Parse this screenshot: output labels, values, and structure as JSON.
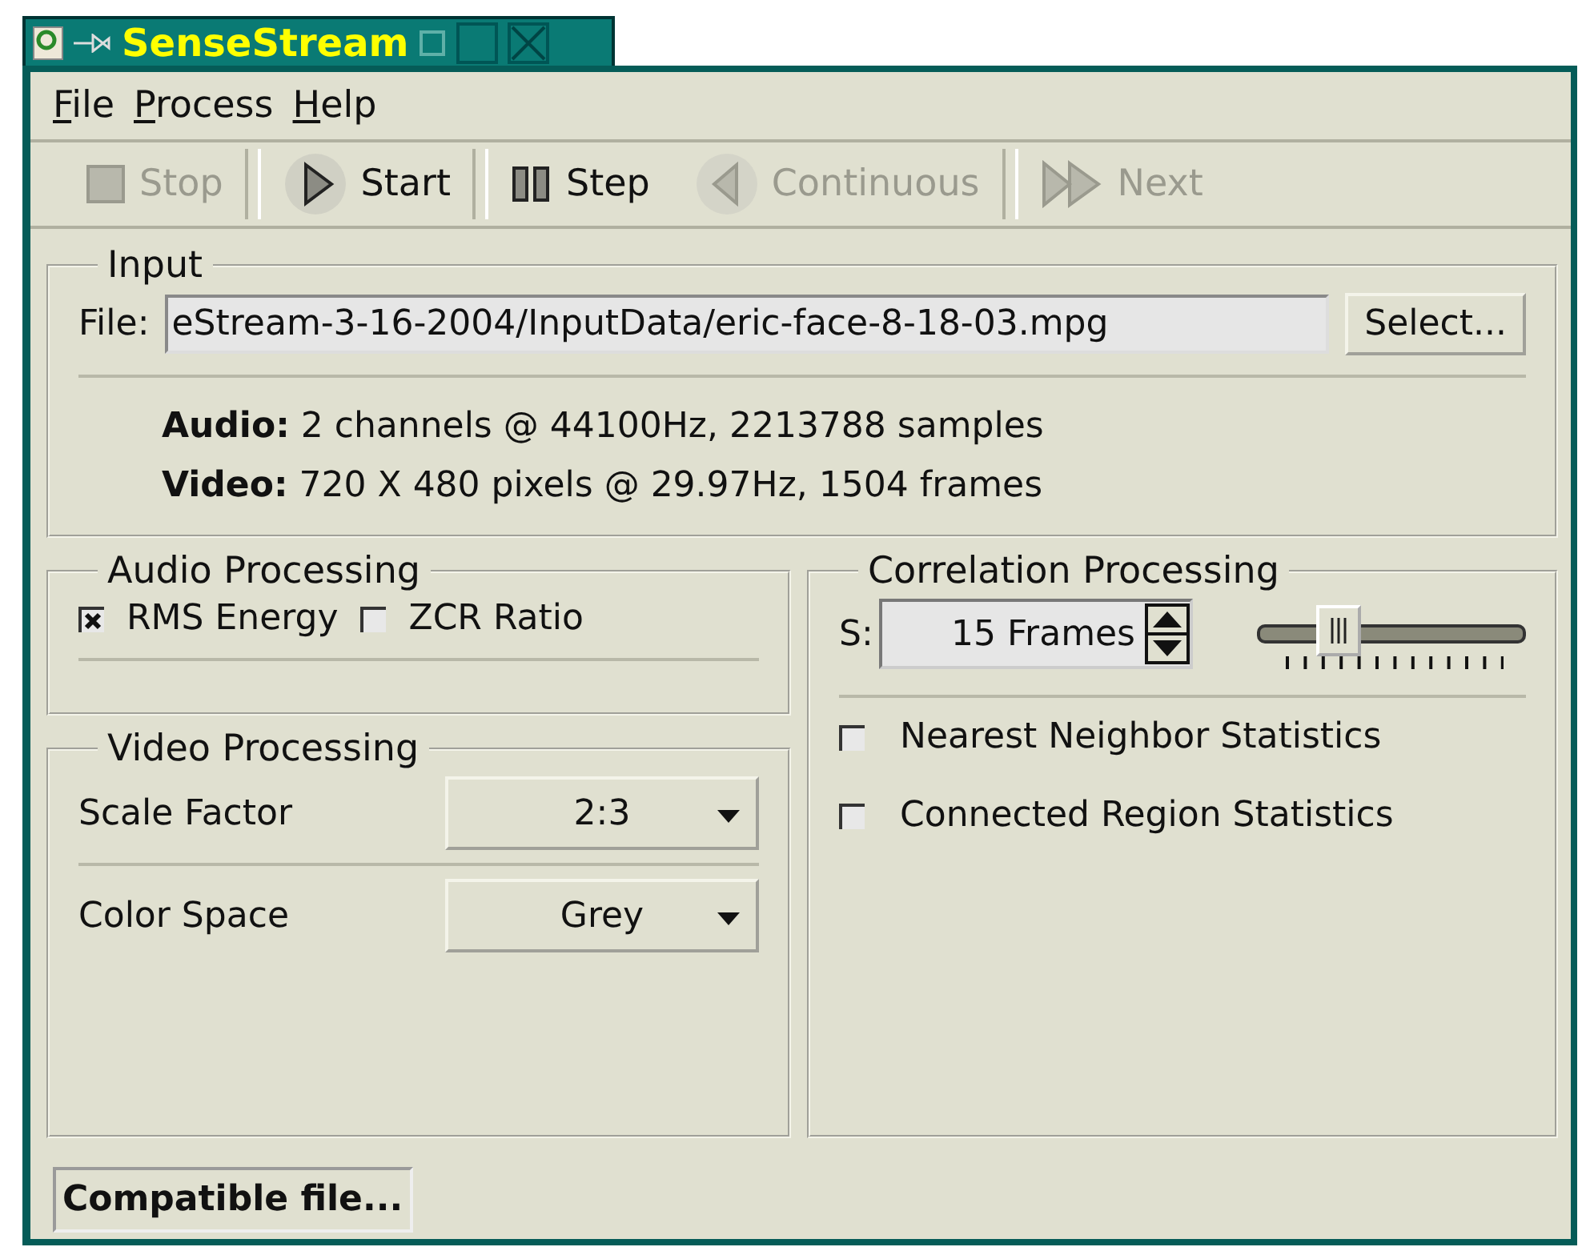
{
  "window": {
    "title": "SenseStream"
  },
  "menu": [
    {
      "label": "File"
    },
    {
      "label": "Process"
    },
    {
      "label": "Help"
    }
  ],
  "toolbar": [
    {
      "label": "Stop",
      "kind": "stop",
      "disabled": true
    },
    {
      "label": "Start",
      "kind": "play",
      "disabled": false
    },
    {
      "label": "Step",
      "kind": "pause",
      "disabled": false
    },
    {
      "label": "Continuous",
      "kind": "back",
      "disabled": true
    },
    {
      "label": "Next",
      "kind": "forward",
      "disabled": true
    }
  ],
  "input": {
    "title": "Input",
    "file_label": "File:",
    "file_value": "eStream-3-16-2004/InputData/eric-face-8-18-03.mpg",
    "select_button": "Select...",
    "info": [
      {
        "label": "Audio:",
        "text": "2 channels @ 44100Hz, 2213788 samples"
      },
      {
        "label": "Video:",
        "text": "720 X 480 pixels @ 29.97Hz, 1504 frames"
      }
    ]
  },
  "audio_processing": {
    "title": "Audio Processing",
    "options": [
      {
        "label": "RMS Energy",
        "checked": true
      },
      {
        "label": "ZCR Ratio",
        "checked": false
      }
    ]
  },
  "video_processing": {
    "title": "Video Processing",
    "fields": [
      {
        "label": "Scale Factor",
        "value": "2:3"
      },
      {
        "label": "Color Space",
        "value": "Grey"
      }
    ]
  },
  "correlation_processing": {
    "title": "Correlation Processing",
    "spin_label": "S:",
    "spin_value": "15 Frames",
    "slider": {
      "level": 0.3
    },
    "options": [
      {
        "label": "Nearest Neighbor Statistics",
        "checked": false
      },
      {
        "label": "Connected Region Statistics",
        "checked": false
      }
    ]
  },
  "status_bar": "Compatible file..."
}
